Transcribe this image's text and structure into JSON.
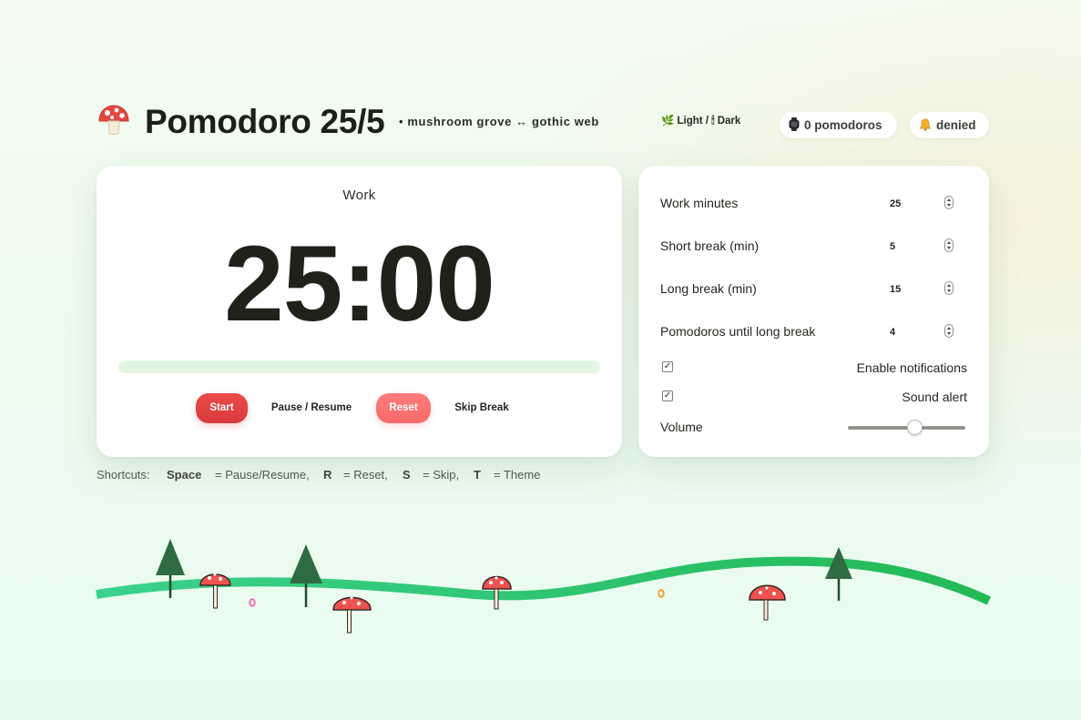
{
  "header": {
    "logo_icon": "mushroom-icon",
    "title": "Pomodoro 25/5",
    "subtitle": "• mushroom grove ↔ gothic web",
    "theme_toggle": {
      "light_icon": "🌿",
      "light_label": "Light /",
      "dark_icon": "🕯",
      "dark_label": "Dark"
    },
    "pomodoro_count": {
      "icon": "watch-icon",
      "label": "0 pomodoros"
    },
    "notification_status": {
      "icon": "bell-icon",
      "label": "denied"
    }
  },
  "timer": {
    "mode": "Work",
    "time": "25:00",
    "progress": 0,
    "buttons": {
      "start": "Start",
      "pause_resume": "Pause / Resume",
      "reset": "Reset",
      "skip": "Skip Break"
    }
  },
  "settings": {
    "work_minutes": {
      "label": "Work minutes",
      "value": "25"
    },
    "short_break": {
      "label": "Short break (min)",
      "value": "5"
    },
    "long_break": {
      "label": "Long break (min)",
      "value": "15"
    },
    "until_long": {
      "label": "Pomodoros until long break",
      "value": "4"
    },
    "notifications": {
      "label": "Enable notifications",
      "checked": true
    },
    "sound": {
      "label": "Sound alert",
      "checked": true
    },
    "volume": {
      "label": "Volume",
      "value": 0.58
    }
  },
  "shortcuts": {
    "prefix": "Shortcuts:",
    "items": [
      {
        "key": "Space",
        "action": "= Pause/Resume,"
      },
      {
        "key": "R",
        "action": "= Reset,"
      },
      {
        "key": "S",
        "action": "= Skip,"
      },
      {
        "key": "T",
        "action": "= Theme"
      }
    ]
  },
  "colors": {
    "accent_red": "#d83a3c",
    "reset_pink": "#f76b6b",
    "grass_green": "#2fcf74",
    "tree_green": "#2c6e41",
    "mushroom_cap": "#f0524f"
  }
}
